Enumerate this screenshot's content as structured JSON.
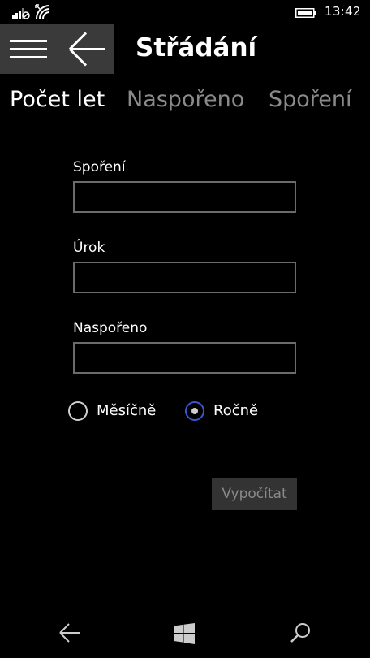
{
  "status_bar": {
    "time": "13:42",
    "icons": [
      "signal-icon",
      "wifi-icon",
      "battery-icon"
    ]
  },
  "header": {
    "title": "Střádání",
    "icons": [
      "hamburger-menu-icon",
      "back-arrow-icon"
    ]
  },
  "tabs": [
    {
      "label": "Počet let",
      "active": true
    },
    {
      "label": "Naspořeno",
      "active": false
    },
    {
      "label": "Spoření",
      "active": false
    }
  ],
  "form": {
    "fields": [
      {
        "label": "Spoření",
        "value": ""
      },
      {
        "label": "Úrok",
        "value": ""
      },
      {
        "label": "Naspořeno",
        "value": ""
      }
    ],
    "radios": [
      {
        "label": "Měsíčně",
        "selected": false
      },
      {
        "label": "Ročně",
        "selected": true
      }
    ],
    "calculate_label": "Vypočítat"
  },
  "nav_bar": {
    "icons": [
      "nav-back-icon",
      "windows-logo-icon",
      "search-icon"
    ]
  },
  "colors": {
    "background": "#000000",
    "header_button_bg": "#3a3a3a",
    "inactive_tab": "#8a8a8a",
    "input_border": "#6b6b6b",
    "radio_accent": "#3a56d4",
    "disabled_button_bg": "#333333"
  }
}
